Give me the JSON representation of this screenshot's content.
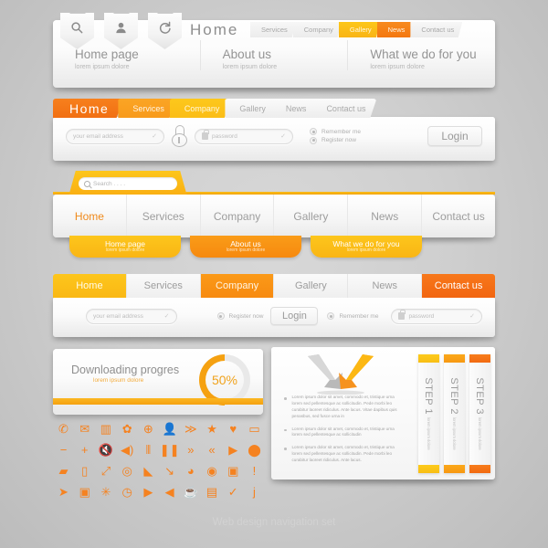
{
  "caption": "Web design navigation set",
  "block1": {
    "tags": [
      {
        "name": "search-icon"
      },
      {
        "name": "user-icon"
      },
      {
        "name": "refresh-icon"
      }
    ],
    "brand": "Home",
    "tabs": [
      {
        "label": "Services",
        "style": "plain"
      },
      {
        "label": "Company",
        "style": "plain"
      },
      {
        "label": "Gallery",
        "style": "gold"
      },
      {
        "label": "News",
        "style": "orange"
      },
      {
        "label": "Contact us",
        "style": "plain"
      }
    ],
    "columns": [
      {
        "title": "Home page",
        "sub": "lorem ipsum dolore"
      },
      {
        "title": "About us",
        "sub": "lorem ipsum dolore"
      },
      {
        "title": "What we do for you",
        "sub": "lorem ipsum dolore"
      }
    ]
  },
  "block2": {
    "nav": [
      {
        "label": "Home",
        "style": "home"
      },
      {
        "label": "Services",
        "style": "o1"
      },
      {
        "label": "Company",
        "style": "o2"
      },
      {
        "label": "Gallery",
        "style": "plain"
      },
      {
        "label": "News",
        "style": "plain"
      },
      {
        "label": "Contact us",
        "style": "plain"
      }
    ],
    "email_placeholder": "your email address",
    "password_placeholder": "password",
    "remember_label": "Remember me",
    "register_label": "Register now",
    "login_label": "Login"
  },
  "block3": {
    "search_placeholder": "Search . . . .",
    "nav": [
      {
        "label": "Home",
        "active": true
      },
      {
        "label": "Services",
        "active": false
      },
      {
        "label": "Company",
        "active": false
      },
      {
        "label": "Gallery",
        "active": false
      },
      {
        "label": "News",
        "active": false
      },
      {
        "label": "Contact us",
        "active": false
      }
    ],
    "subtabs": [
      {
        "title": "Home page",
        "sub": "lorem ipsum dolore",
        "style": "y"
      },
      {
        "title": "About us",
        "sub": "lorem ipsum dolore",
        "style": "o"
      },
      {
        "title": "What we do for you",
        "sub": "lorem ipsum dolore",
        "style": "y"
      }
    ]
  },
  "block4": {
    "nav": [
      {
        "label": "Home",
        "style": "y"
      },
      {
        "label": "Services",
        "style": "plain"
      },
      {
        "label": "Company",
        "style": "o"
      },
      {
        "label": "Gallery",
        "style": "plain"
      },
      {
        "label": "News",
        "style": "plain"
      },
      {
        "label": "Contact us",
        "style": "r"
      }
    ],
    "email_placeholder": "your email address",
    "password_placeholder": "password",
    "register_label": "Register now",
    "remember_label": "Remember me",
    "login_label": "Login"
  },
  "progress": {
    "title": "Downloading progres",
    "subtitle": "lorem ipsum dolore",
    "percent": "50%",
    "value": 50,
    "accent": "#f5a111"
  },
  "steps": {
    "bullets": [
      "Lorem ipsum dolor sit amet, commodo et, tristique urna lorem sed pellentesque ac sollicitudin. Pede morbi leo curabitur laoreet ridiculus. Ante lacus. Vitae dapibus quis penasbus, sed fusce urna in",
      "Lorem ipsum dolor sit amet, commodo et, tristique urna lorem sed pellentesque ac sollicitudin",
      "Lorem ipsum dolor sit amet, commodo et, tristique urna lorem sed pellentesque ac sollicitudin. Pede morbi leo curabitur laoreet ridiculus. Ante lacus."
    ],
    "cards": [
      {
        "label": "STEP 1",
        "sub": "lorem ipsum dolore",
        "style": "c1"
      },
      {
        "label": "STEP 2",
        "sub": "lorem ipsum dolore",
        "style": "c2"
      },
      {
        "label": "STEP 3",
        "sub": "lorem ipsum dolore",
        "style": "c3"
      }
    ]
  },
  "icons": {
    "color": "#f58220",
    "rows": [
      [
        "phone-icon",
        "envelope-icon",
        "briefcase-icon",
        "gear-icon",
        "globe-icon",
        "user-icon",
        "rss-icon",
        "star-icon",
        "heart-icon",
        "speech-bubble-icon"
      ],
      [
        "minus-icon",
        "plus-icon",
        "mute-icon",
        "volume-icon",
        "sliders-icon",
        "pause-icon",
        "fast-forward-icon",
        "rewind-icon",
        "play-icon",
        "shield-icon"
      ],
      [
        "folder-icon",
        "trash-icon",
        "expand-icon",
        "lifebuoy-icon",
        "tag-icon",
        "microphone-icon",
        "pie-chart-icon",
        "eye-icon",
        "save-icon",
        "alert-icon"
      ],
      [
        "pin-icon",
        "camera-icon",
        "asterisk-icon",
        "clock-icon",
        "next-icon",
        "previous-icon",
        "coffee-icon",
        "video-camera-icon",
        "check-icon",
        "info-icon"
      ]
    ]
  }
}
